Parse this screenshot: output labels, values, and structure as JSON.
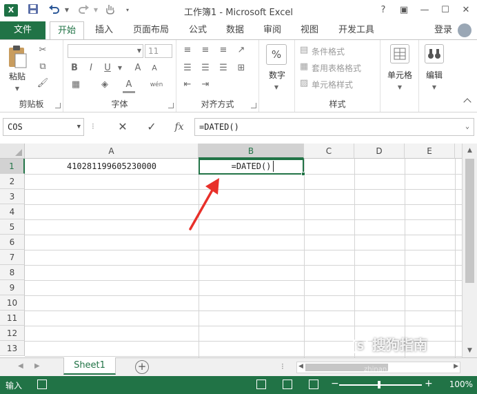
{
  "app": {
    "title": "工作簿1 - Microsoft Excel"
  },
  "titlebar": {
    "logo_text": "X",
    "help": "?",
    "restore": "▣",
    "minimize": "—",
    "maximize": "☐",
    "close": "✕"
  },
  "ribbon_tabs": [
    "文件",
    "开始",
    "插入",
    "页面布局",
    "公式",
    "数据",
    "审阅",
    "视图",
    "开发工具"
  ],
  "active_tab": "开始",
  "login": "登录",
  "ribbon": {
    "clipboard": {
      "paste": "粘贴",
      "label": "剪贴板"
    },
    "font": {
      "font_size": "11",
      "bold": "B",
      "italic": "I",
      "underline": "U",
      "grow": "A",
      "shrink": "A",
      "color": "A",
      "phonetic": "wén",
      "label": "字体"
    },
    "alignment": {
      "label": "对齐方式"
    },
    "number": {
      "symbol": "%",
      "label": "数字"
    },
    "styles": {
      "conditional": "条件格式",
      "table": "套用表格格式",
      "cell_styles": "单元格样式",
      "label": "样式"
    },
    "cells": {
      "label": "单元格"
    },
    "editing": {
      "label": "编辑"
    }
  },
  "formula_bar": {
    "name_box": "COS",
    "cancel": "✕",
    "confirm": "✓",
    "fx": "fx",
    "content": "=DATED()"
  },
  "grid": {
    "columns": [
      "A",
      "B",
      "C",
      "D",
      "E"
    ],
    "selected_column": "B",
    "rows": [
      "1",
      "2",
      "3",
      "4",
      "5",
      "6",
      "7",
      "8",
      "9",
      "10",
      "11",
      "12",
      "13"
    ],
    "selected_row": "1",
    "cells": {
      "A1": "410281199605230000",
      "B1": "=DATED()"
    }
  },
  "sheets": [
    "Sheet1"
  ],
  "status": {
    "mode": "输入",
    "zoom": "100%"
  },
  "watermark": {
    "brand": "搜狗指南",
    "url": "zhinan.sogou.com"
  },
  "colors": {
    "brand": "#217346",
    "annotation_arrow": "#e8302a"
  }
}
